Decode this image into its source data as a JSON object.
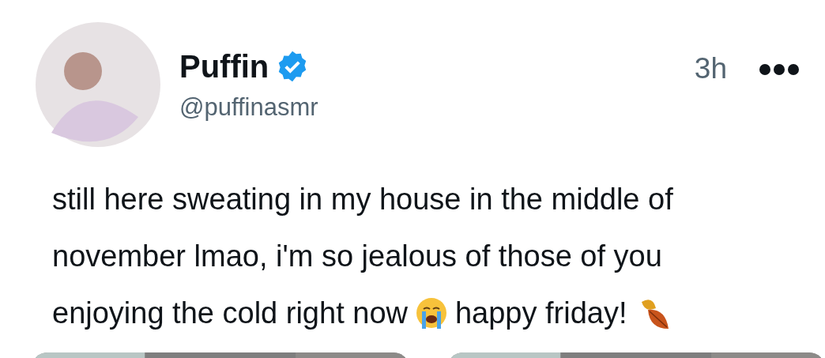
{
  "post": {
    "author": {
      "name": "Puffin",
      "verified": true,
      "handle": "@puffinasmr"
    },
    "time": "3h",
    "lines": [
      [
        {
          "kind": "text",
          "text": "still here sweating in my house in the middle of"
        }
      ],
      [
        {
          "kind": "text",
          "text": "november lmao, i'm so jealous of those of you"
        }
      ],
      [
        {
          "kind": "text",
          "text": "enjoying the cold right now"
        },
        {
          "kind": "emoji"
        },
        {
          "kind": "text",
          "text": "happy friday!"
        },
        {
          "kind": "leaf"
        }
      ]
    ],
    "media": [
      {
        "kind": "picture"
      },
      {
        "kind": "picture"
      }
    ]
  }
}
